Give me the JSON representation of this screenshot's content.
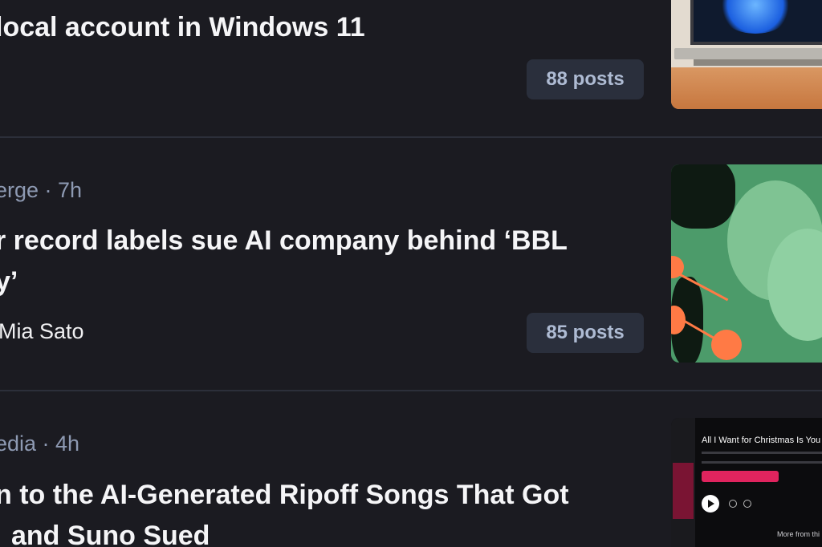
{
  "feed": {
    "items": [
      {
        "headline_line1": "local account in Windows 11",
        "posts_label": "88 posts",
        "thumbnail": "windows-laptop-image"
      },
      {
        "meta": "erge · 7h",
        "headline_line1": "r record labels sue AI company behind ‘BBL",
        "headline_line2": "y’",
        "byline": "Mia Sato",
        "posts_label": "85 posts",
        "thumbnail": "green-faces-collage-image"
      },
      {
        "meta": "edia · 4h",
        "headline_line1": "n to the AI-Generated Ripoff Songs That Got",
        "headline_line2": "and Suno Sued",
        "thumbnail": "music-app-screenshot-image",
        "thumbnail_texts": {
          "title": "All I Want for Christmas Is You",
          "more": "More from thi"
        }
      }
    ]
  },
  "colors": {
    "background": "#1b1b21",
    "meta": "#8e9ab3",
    "button_bg": "#2a2f3c",
    "button_text": "#aebbd3",
    "divider": "#2c2f3a"
  }
}
